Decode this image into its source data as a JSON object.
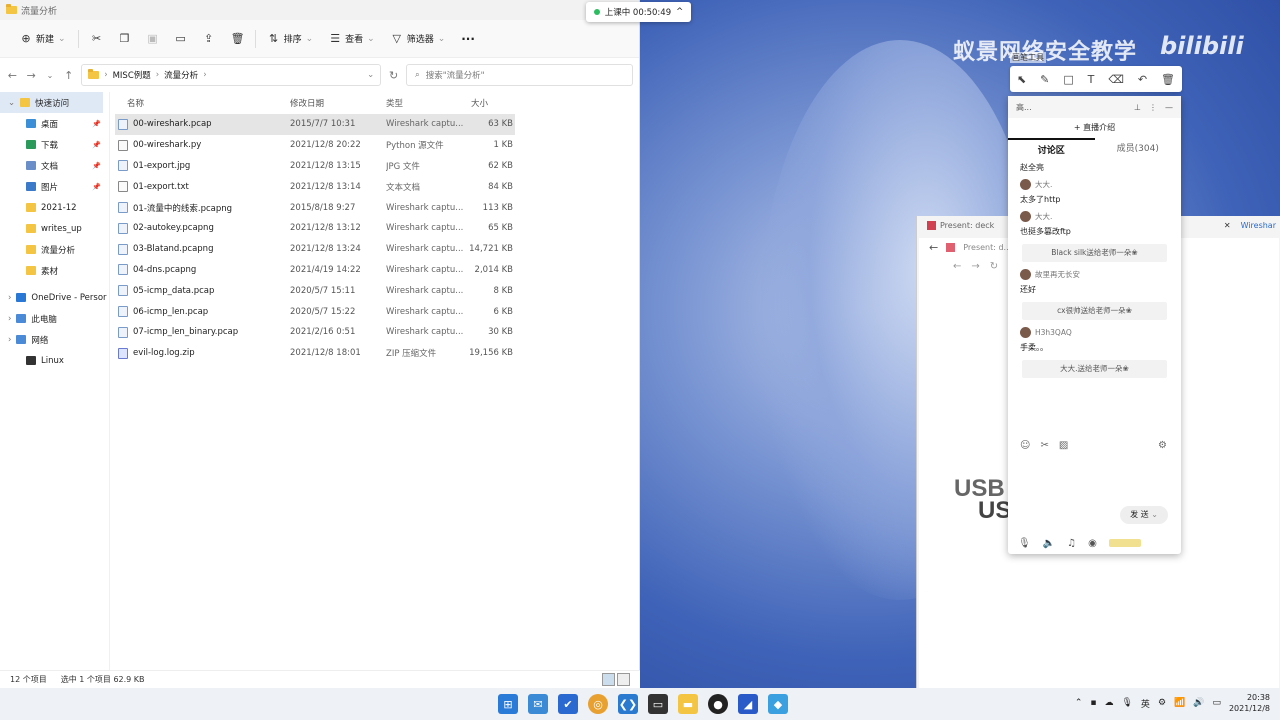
{
  "explorer": {
    "window_title": "流量分析",
    "toolbar": {
      "new": "新建",
      "sort": "排序",
      "view": "查看",
      "filter": "筛选器",
      "more": "···"
    },
    "address": {
      "crumbs": [
        "MISC例题",
        "流量分析"
      ],
      "search_placeholder": "搜索\"流量分析\""
    },
    "sidebar": [
      {
        "label": "快速访问",
        "pinned": false,
        "color": "#f4c542"
      },
      {
        "label": "桌面",
        "pinned": true,
        "color": "#3a8fd6"
      },
      {
        "label": "下载",
        "pinned": true,
        "color": "#2a9a5a"
      },
      {
        "label": "文档",
        "pinned": true,
        "color": "#6a8fc8"
      },
      {
        "label": "图片",
        "pinned": true,
        "color": "#3a7ac8"
      },
      {
        "label": "2021-12",
        "pinned": false,
        "color": "#f4c542"
      },
      {
        "label": "writes_up",
        "pinned": false,
        "color": "#f4c542"
      },
      {
        "label": "流量分析",
        "pinned": false,
        "color": "#f4c542"
      },
      {
        "label": "素材",
        "pinned": false,
        "color": "#f4c542"
      },
      {
        "label": "OneDrive - Persor",
        "pinned": false,
        "color": "#2a78d6"
      },
      {
        "label": "此电脑",
        "pinned": false,
        "color": "#4a8ad6"
      },
      {
        "label": "网络",
        "pinned": false,
        "color": "#4a8ad6"
      },
      {
        "label": "Linux",
        "pinned": false,
        "color": "#333333"
      }
    ],
    "columns": {
      "name": "名称",
      "date": "修改日期",
      "type": "类型",
      "size": "大小"
    },
    "files": [
      {
        "name": "00-wireshark.pcap",
        "date": "2015/7/7 10:31",
        "type": "Wireshark captu...",
        "size": "63 KB",
        "selected": true,
        "icon": "pcap"
      },
      {
        "name": "00-wireshark.py",
        "date": "2021/12/8 20:22",
        "type": "Python 源文件",
        "size": "1 KB",
        "selected": false,
        "icon": "py"
      },
      {
        "name": "01-export.jpg",
        "date": "2021/12/8 13:15",
        "type": "JPG 文件",
        "size": "62 KB",
        "selected": false,
        "icon": "jpg"
      },
      {
        "name": "01-export.txt",
        "date": "2021/12/8 13:14",
        "type": "文本文档",
        "size": "84 KB",
        "selected": false,
        "icon": "txt"
      },
      {
        "name": "01-流量中的线索.pcapng",
        "date": "2015/8/18 9:27",
        "type": "Wireshark captu...",
        "size": "113 KB",
        "selected": false,
        "icon": "pcap"
      },
      {
        "name": "02-autokey.pcapng",
        "date": "2021/12/8 13:12",
        "type": "Wireshark captu...",
        "size": "65 KB",
        "selected": false,
        "icon": "pcap"
      },
      {
        "name": "03-Blatand.pcapng",
        "date": "2021/12/8 13:24",
        "type": "Wireshark captu...",
        "size": "14,721 KB",
        "selected": false,
        "icon": "pcap"
      },
      {
        "name": "04-dns.pcapng",
        "date": "2021/4/19 14:22",
        "type": "Wireshark captu...",
        "size": "2,014 KB",
        "selected": false,
        "icon": "pcap"
      },
      {
        "name": "05-icmp_data.pcap",
        "date": "2020/5/7 15:11",
        "type": "Wireshark captu...",
        "size": "8 KB",
        "selected": false,
        "icon": "pcap"
      },
      {
        "name": "06-icmp_len.pcap",
        "date": "2020/5/7 15:22",
        "type": "Wireshark captu...",
        "size": "6 KB",
        "selected": false,
        "icon": "pcap"
      },
      {
        "name": "07-icmp_len_binary.pcap",
        "date": "2021/2/16 0:51",
        "type": "Wireshark captu...",
        "size": "30 KB",
        "selected": false,
        "icon": "pcap"
      },
      {
        "name": "evil-log.log.zip",
        "date": "2021/12/8 18:01",
        "type": "ZIP 压缩文件",
        "size": "19,156 KB",
        "selected": false,
        "icon": "zip"
      }
    ],
    "status": {
      "count": "12 个项目",
      "selected": "选中 1 个项目  62.9 KB"
    }
  },
  "timer": {
    "label": "上课中 00:50:49",
    "arrow": "^"
  },
  "watermark": {
    "text": "蚁景网络安全教学",
    "logo": "bilibili"
  },
  "browser": {
    "tab1": "Present: deck",
    "tab2": "Present: d...",
    "tab3": "Wireshar",
    "big_text_1": "USB",
    "big_text_2": "US"
  },
  "draw_tools": {
    "label": "画笔工具"
  },
  "chat": {
    "top_title": "高...",
    "intro": "+ 直播介绍",
    "tab_discuss": "讨论区",
    "tab_members": "成员(304)",
    "items": [
      {
        "kind": "msg",
        "text": "赵全亮"
      },
      {
        "kind": "name",
        "text": "大大."
      },
      {
        "kind": "msg",
        "text": "太多了http"
      },
      {
        "kind": "name",
        "text": "大大."
      },
      {
        "kind": "msg",
        "text": "也挺多篡改ftp"
      },
      {
        "kind": "gift",
        "text": "Black silk送给老师一朵❀"
      },
      {
        "kind": "name",
        "text": "故里再无长安"
      },
      {
        "kind": "msg",
        "text": "还好"
      },
      {
        "kind": "gift",
        "text": "cx很帅送给老师一朵❀"
      },
      {
        "kind": "name",
        "text": "H3h3QAQ"
      },
      {
        "kind": "msg",
        "text": "手柔。。"
      },
      {
        "kind": "gift",
        "text": "大大.送给老师一朵❀"
      }
    ],
    "send": "发 送",
    "send_arrow": "⌄"
  },
  "taskbar": {
    "tray_lang": "英",
    "time": "20:38",
    "date": "2021/12/8"
  }
}
